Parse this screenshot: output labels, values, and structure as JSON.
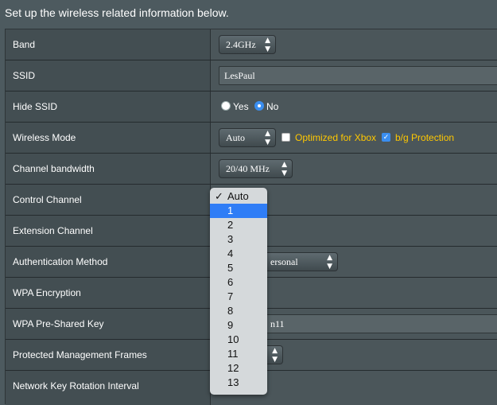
{
  "intro": "Set up the wireless related information below.",
  "rows": {
    "band": {
      "label": "Band",
      "value": "2.4GHz"
    },
    "ssid": {
      "label": "SSID",
      "value": "LesPaul"
    },
    "hide_ssid": {
      "label": "Hide SSID",
      "yes": "Yes",
      "no": "No",
      "selected": "No"
    },
    "wireless_mode": {
      "label": "Wireless Mode",
      "value": "Auto",
      "xbox_label": "Optimized for Xbox",
      "xbox_checked": false,
      "bg_label": "b/g Protection",
      "bg_checked": true
    },
    "channel_bandwidth": {
      "label": "Channel bandwidth",
      "value": "20/40 MHz"
    },
    "control_channel": {
      "label": "Control Channel"
    },
    "extension_channel": {
      "label": "Extension Channel"
    },
    "auth_method": {
      "label": "Authentication Method",
      "value_fragment": "ersonal"
    },
    "wpa_encryption": {
      "label": "WPA Encryption"
    },
    "wpa_key": {
      "label": "WPA Pre-Shared Key",
      "value_fragment": "n11"
    },
    "pmf": {
      "label": "Protected Management Frames"
    },
    "key_rotation": {
      "label": "Network Key Rotation Interval"
    }
  },
  "dropdown": {
    "options": [
      "Auto",
      "1",
      "2",
      "3",
      "4",
      "5",
      "6",
      "7",
      "8",
      "9",
      "10",
      "11",
      "12",
      "13"
    ],
    "checked": "Auto",
    "highlighted": "1",
    "check_glyph": "✓"
  },
  "glyphs": {
    "updown": "▲▼"
  },
  "colors": {
    "accent_blue": "#2f7df6",
    "label_yellow": "#ffc800"
  }
}
